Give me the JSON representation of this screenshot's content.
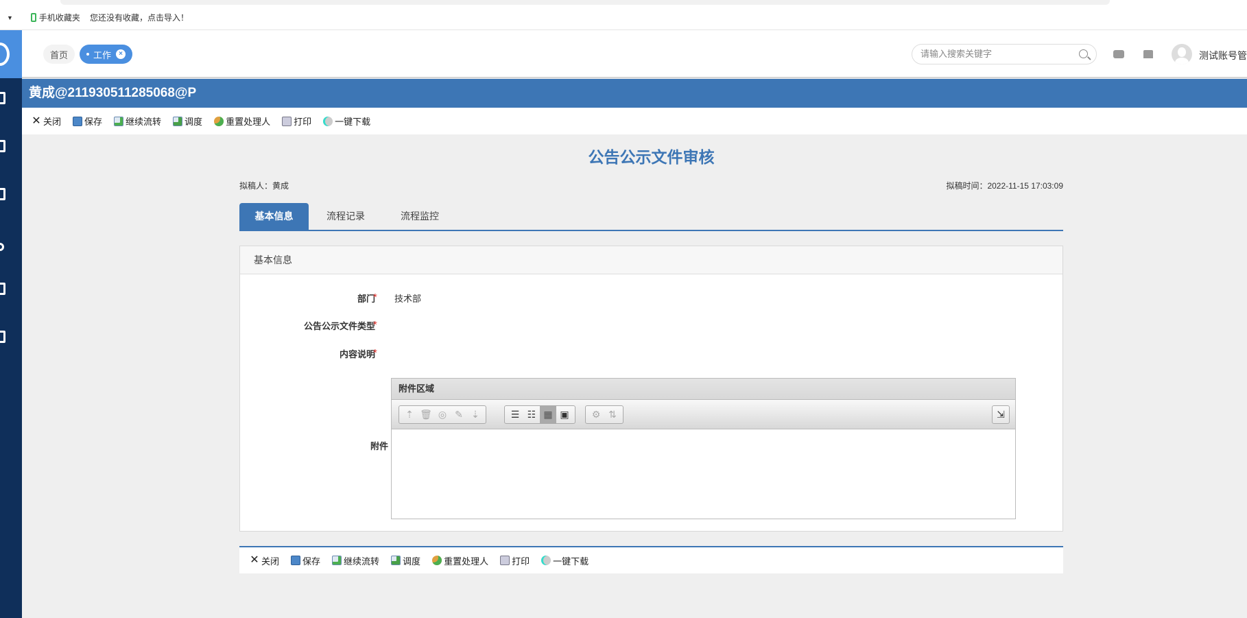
{
  "bookmarks": {
    "mobile_favorites": "手机收藏夹",
    "empty_hint": "您还没有收藏，点击导入！"
  },
  "header": {
    "tabs": [
      {
        "label": "首页"
      },
      {
        "label": "工作"
      }
    ],
    "search_placeholder": "请输入搜索关键字",
    "username": "测试账号管"
  },
  "title_bar": "黄成@211930511285068@P",
  "toolbar": {
    "close": "关闭",
    "save": "保存",
    "continue": "继续流转",
    "dispatch": "调度",
    "reset_handler": "重置处理人",
    "print": "打印",
    "download_all": "一键下载"
  },
  "document": {
    "title": "公告公示文件审核",
    "drafter": "拟稿人：黄成",
    "draft_time": "拟稿时间：2022-11-15 17:03:09"
  },
  "tabs": [
    {
      "label": "基本信息",
      "active": true
    },
    {
      "label": "流程记录"
    },
    {
      "label": "流程监控"
    }
  ],
  "panel": {
    "title": "基本信息",
    "fields": [
      {
        "label": "部门",
        "required": true,
        "value": "技术部"
      },
      {
        "label": "公告公示文件类型",
        "required": true,
        "value": ""
      },
      {
        "label": "内容说明",
        "required": true,
        "value": ""
      },
      {
        "label": "附件"
      }
    ],
    "attachment_area_title": "附件区域"
  },
  "colors": {
    "primary": "#3d76b5",
    "sidebar": "#0f2f5a",
    "accent": "#4a8fe0",
    "required": "#e53935"
  }
}
